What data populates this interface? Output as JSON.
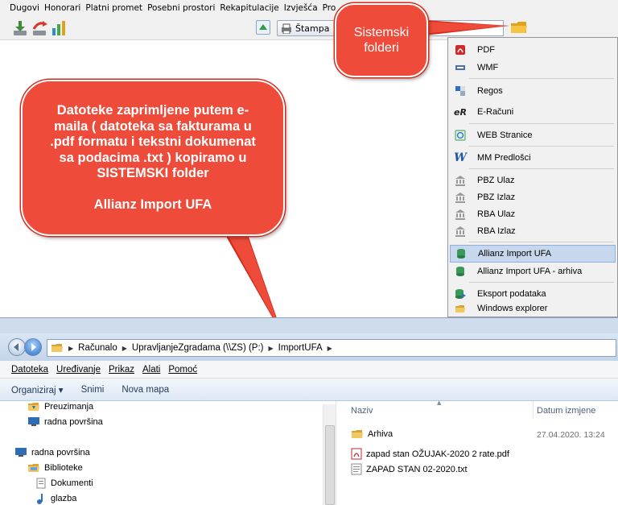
{
  "app": {
    "menu": [
      "Dugovi",
      "Honorari",
      "Platni promet",
      "Posebni prostori",
      "Rekapitulacije",
      "Izvješća",
      "Pro"
    ],
    "print_button": "Štampa"
  },
  "callouts": {
    "small": {
      "lines": [
        "Sistemski",
        "folderi"
      ]
    },
    "big": {
      "lines": [
        "Datoteke zaprimljene putem e-",
        "maila ( datoteka sa fakturama u",
        ".pdf formatu i tekstni dokumenat",
        "sa podacima .txt ) kopiramo u",
        "SISTEMSKI folder"
      ],
      "highlight": "Allianz Import UFA"
    }
  },
  "dropdown": {
    "items": [
      {
        "label": "PDF",
        "icon": "pdf-icon"
      },
      {
        "label": "WMF",
        "icon": "wmf-icon"
      },
      {
        "label": "Regos",
        "icon": "regos-icon"
      },
      {
        "label": "E-Računi",
        "icon": "eracuni-icon"
      },
      {
        "label": "WEB Stranice",
        "icon": "web-icon"
      },
      {
        "label": "MM Predlošci",
        "icon": "word-icon"
      },
      {
        "label": "PBZ Ulaz",
        "icon": "bank-icon"
      },
      {
        "label": "PBZ Izlaz",
        "icon": "bank-icon"
      },
      {
        "label": "RBA Ulaz",
        "icon": "bank-icon"
      },
      {
        "label": "RBA Izlaz",
        "icon": "bank-icon"
      },
      {
        "label": "Allianz Import UFA",
        "icon": "database-icon",
        "selected": true
      },
      {
        "label": "Allianz Import UFA - arhiva",
        "icon": "database-icon"
      },
      {
        "label": "Eksport podataka",
        "icon": "database-export-icon"
      },
      {
        "label": "Windows explorer",
        "icon": "folder-icon"
      }
    ]
  },
  "explorer": {
    "breadcrumb": [
      "Računalo",
      "UpravljanjeZgradama (\\\\ZS) (P:)",
      "ImportUFA"
    ],
    "menu": [
      "Datoteka",
      "Uređivanje",
      "Prikaz",
      "Alati",
      "Pomoć"
    ],
    "commands": [
      "Organiziraj ▾",
      "Snimi",
      "Nova mapa"
    ],
    "nav_items": [
      "Preuzimanja",
      "radna površina",
      "radna površina",
      "Biblioteke",
      "Dokumenti",
      "glazba"
    ],
    "columns": {
      "name": "Naziv",
      "date": "Datum izmjene"
    },
    "files": [
      {
        "name": "Arhiva",
        "date": "27.04.2020. 13:24",
        "icon": "folder-icon"
      },
      {
        "name": "zapad stan OŽUJAK-2020 2 rate.pdf",
        "date": "",
        "icon": "pdf-file-icon"
      },
      {
        "name": "ZAPAD STAN 02-2020.txt",
        "date": "",
        "icon": "text-file-icon"
      }
    ]
  },
  "colors": {
    "callout_red": "#ee4b3a",
    "highlight": "#c6d7ee"
  }
}
